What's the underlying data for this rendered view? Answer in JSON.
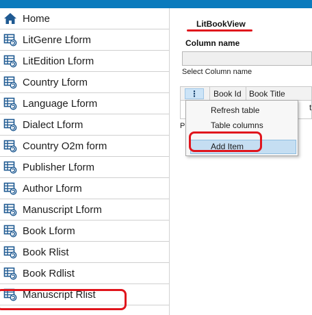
{
  "app": {
    "titlebar_color": "#0b7bbd",
    "accent_red": "#e0141c"
  },
  "sidebar": {
    "items": [
      {
        "label": "Home",
        "icon": "home-icon"
      },
      {
        "label": "LitGenre Lform",
        "icon": "form-refresh-icon"
      },
      {
        "label": "LitEdition Lform",
        "icon": "form-refresh-icon"
      },
      {
        "label": "Country Lform",
        "icon": "form-refresh-icon"
      },
      {
        "label": "Language Lform",
        "icon": "form-refresh-icon"
      },
      {
        "label": "Dialect Lform",
        "icon": "form-refresh-icon"
      },
      {
        "label": "Country O2m form",
        "icon": "form-refresh-icon"
      },
      {
        "label": "Publisher Lform",
        "icon": "form-refresh-icon"
      },
      {
        "label": "Author Lform",
        "icon": "form-refresh-icon"
      },
      {
        "label": "Manuscript Lform",
        "icon": "form-refresh-icon"
      },
      {
        "label": "Book Lform",
        "icon": "form-refresh-icon"
      },
      {
        "label": "Book Rlist",
        "icon": "form-refresh-icon"
      },
      {
        "label": "Book Rdlist",
        "icon": "form-refresh-icon"
      },
      {
        "label": "Manuscript Rlist",
        "icon": "form-refresh-icon"
      }
    ]
  },
  "main": {
    "view_title": "LitBookView",
    "column_name_label": "Column name",
    "column_name_value": "",
    "column_hint": "Select Column name",
    "grid": {
      "menu_button": "⋮",
      "columns": [
        "Book Id",
        "Book Title"
      ],
      "row_cell": "the"
    },
    "side_letter": "P"
  },
  "context_menu": {
    "items": [
      {
        "label": "Refresh table"
      },
      {
        "label": "Table columns"
      },
      {
        "label": "Add Item"
      }
    ]
  }
}
